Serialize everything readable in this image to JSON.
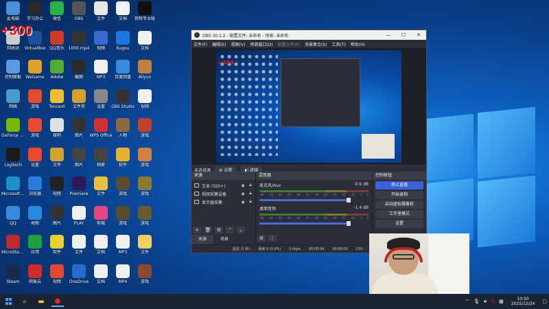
{
  "desktop": {
    "counter_overlay": "+300",
    "icons": [
      {
        "label": "此电脑",
        "color": "#4a8fd8"
      },
      {
        "label": "学习办公",
        "color": "#2a2a2a"
      },
      {
        "label": "微信",
        "color": "#27b34a"
      },
      {
        "label": "OBS",
        "color": "#555"
      },
      {
        "label": "文件",
        "color": "#e8e8e8"
      },
      {
        "label": "文档",
        "color": "#f2f2f2"
      },
      {
        "label": "剪映专业版",
        "color": "#111"
      },
      {
        "label": "回收站",
        "color": "#ccc"
      },
      {
        "label": "VirtualBox",
        "color": "#1d4f9a"
      },
      {
        "label": "QQ音乐",
        "color": "#cc3a2a"
      },
      {
        "label": "1000.mp4",
        "color": "#333"
      },
      {
        "label": "视频",
        "color": "#3a6ad0"
      },
      {
        "label": "Kugou",
        "color": "#1e78e0"
      },
      {
        "label": "文档",
        "color": "#f2f2f2"
      },
      {
        "label": "控制面板",
        "color": "#5a9ae0"
      },
      {
        "label": "WeGame",
        "color": "#e0a030"
      },
      {
        "label": "Adobe",
        "color": "#5a3",
        "id": "a"
      },
      {
        "label": "截图",
        "color": "#2a2a2a"
      },
      {
        "label": "MP3",
        "color": "#f0f0f0"
      },
      {
        "label": "百度网盘",
        "color": "#3a8ae0"
      },
      {
        "label": "Aliyun",
        "color": "#c08040"
      },
      {
        "label": "网络",
        "color": "#4a9ad0"
      },
      {
        "label": "游戏",
        "color": "#e84a30"
      },
      {
        "label": "Tencent",
        "color": "#e8c030"
      },
      {
        "label": "文件夹",
        "color": "#d4a030"
      },
      {
        "label": "设置",
        "color": "#888"
      },
      {
        "label": "OBS Studio",
        "color": "#333"
      },
      {
        "label": "视频",
        "color": "#f0f0f0"
      },
      {
        "label": "GeForce Experience",
        "color": "#76b900"
      },
      {
        "label": "游戏",
        "color": "#e84a30"
      },
      {
        "label": "搜狗",
        "color": "#e0e0e0"
      },
      {
        "label": "图片",
        "color": "#333"
      },
      {
        "label": "WPS Office",
        "color": "#d03030"
      },
      {
        "label": "人物",
        "color": "#8a6a40"
      },
      {
        "label": "游戏",
        "color": "#c04030"
      },
      {
        "label": "Logitech",
        "color": "#1a1a1a"
      },
      {
        "label": "设置",
        "color": "#e84a30"
      },
      {
        "label": "文件",
        "color": "#d4a030"
      },
      {
        "label": "图片",
        "color": "#444"
      },
      {
        "label": "相册",
        "color": "#444"
      },
      {
        "label": "软件",
        "color": "#e8b030"
      },
      {
        "label": "游戏",
        "color": "#d08040"
      },
      {
        "label": "Microsoft Edge",
        "color": "#1e90c8"
      },
      {
        "label": "浏览器",
        "color": "#2a7ae0"
      },
      {
        "label": "视频",
        "color": "#222"
      },
      {
        "label": "Premiere",
        "color": "#2a1a5a"
      },
      {
        "label": "文件",
        "color": "#e8c040"
      },
      {
        "label": "游戏",
        "color": "#5a4a3a"
      },
      {
        "label": "游戏",
        "color": "#8a7a30"
      },
      {
        "label": "QQ",
        "color": "#3a8ae0"
      },
      {
        "label": "地图",
        "color": "#2a8ae0"
      },
      {
        "label": "图片",
        "color": "#333"
      },
      {
        "label": "PLAY",
        "color": "#f0f0f0"
      },
      {
        "label": "剪辑",
        "color": "#e04a80"
      },
      {
        "label": "游戏",
        "color": "#5a4a30"
      },
      {
        "label": "游戏",
        "color": "#6a5a30"
      },
      {
        "label": "MicroStation",
        "color": "#c02a2a"
      },
      {
        "label": "应用",
        "color": "#20a040"
      },
      {
        "label": "软件",
        "color": "#e8d030"
      },
      {
        "label": "文件",
        "color": "#f0f0f0"
      },
      {
        "label": "文档",
        "color": "#f0f0f0"
      },
      {
        "label": "MP3",
        "color": "#f0f0f0"
      },
      {
        "label": "文件",
        "color": "#f0d060"
      },
      {
        "label": "Steam",
        "color": "#1a2a4a"
      },
      {
        "label": "网易云",
        "color": "#d02a2a"
      },
      {
        "label": "视频",
        "color": "#e04a30"
      },
      {
        "label": "OneDrive",
        "color": "#2a6ad0"
      },
      {
        "label": "文档",
        "color": "#f0f0f0"
      },
      {
        "label": "MP4",
        "color": "#f0f0f0"
      },
      {
        "label": "游戏",
        "color": "#8a4a30"
      }
    ]
  },
  "obs": {
    "title": "OBS 30.1.2 - 配置文件: 未命名 - 场景: 未命名",
    "menu": [
      "文件(F)",
      "编辑(E)",
      "视图(V)",
      "停靠窗口(D)",
      "配置文件(P)",
      "场景集合(S)",
      "工具(T)",
      "帮助(H)"
    ],
    "source_bar": {
      "no_source": "未选择源",
      "settings": "设置",
      "filters": "滤镜"
    },
    "sources": {
      "title": "来源",
      "items": [
        {
          "label": "文本 (GDI+)"
        },
        {
          "label": "视频采集设备"
        },
        {
          "label": "显示器采集"
        }
      ],
      "tabs": [
        "来源",
        "场景"
      ]
    },
    "mixer": {
      "title": "混音器",
      "channels": [
        {
          "name": "麦克风/Aux",
          "db": "-0.6 dB"
        },
        {
          "name": "桌面音频",
          "db": "-1.4 dB"
        }
      ],
      "ticks": [
        "-60",
        "-55",
        "-50",
        "-45",
        "-40",
        "-35",
        "-30",
        "-25",
        "-20",
        "-15",
        "-10",
        "-5",
        "0"
      ]
    },
    "controls": {
      "title": "控制按钮",
      "stop_stream": "停止直播",
      "start_record": "开始录制",
      "virtual_cam": "启动虚拟摄像机",
      "studio_mode": "工作室模式",
      "settings": "设置"
    },
    "status": {
      "delay": "延迟 (1 秒)",
      "dropped": "丢帧 0 (0.0%)",
      "bitrate": "0 kbps",
      "time1": "00:00:04",
      "time2": "00:00:00",
      "cpu": "CPU"
    }
  },
  "taskbar": {
    "time": "10:50",
    "date": "2025/12/24"
  }
}
